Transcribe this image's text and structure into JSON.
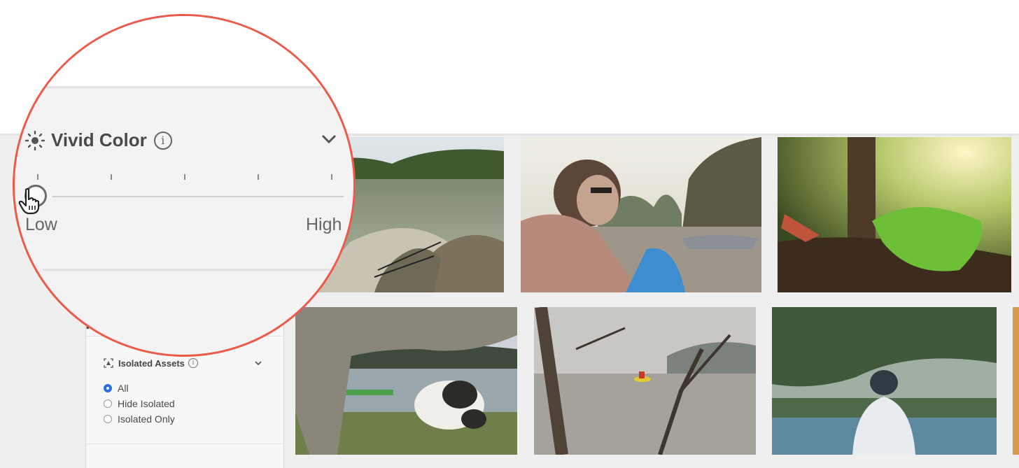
{
  "filters": {
    "vivid_color": {
      "title": "Vivid Color",
      "info_glyph": "i",
      "slider_value": 0,
      "low_label": "Low",
      "high_label": "High",
      "ticks": 5
    },
    "people": {
      "heading_partial": "ple"
    },
    "isolated_assets": {
      "label": "Isolated Assets",
      "info_glyph": "i",
      "options": [
        {
          "label": "All",
          "selected": true
        },
        {
          "label": "Hide Isolated",
          "selected": false
        },
        {
          "label": "Isolated Only",
          "selected": false
        }
      ]
    }
  },
  "photos": [
    {
      "name": "kayak-lake-feet-photo"
    },
    {
      "name": "woman-kayak-sunglasses-photo"
    },
    {
      "name": "green-kayak-forest-photo"
    },
    {
      "name": "goat-grazing-lake-photo"
    },
    {
      "name": "kayakers-fog-branches-photo"
    },
    {
      "name": "child-river-trees-photo"
    }
  ],
  "colors": {
    "lens_border": "#ec5a4a",
    "radio_selected": "#2d6fe0"
  },
  "icons": [
    "sun-icon",
    "info-icon",
    "chevron-down-icon",
    "hand-cursor-icon",
    "isolate-icon"
  ]
}
